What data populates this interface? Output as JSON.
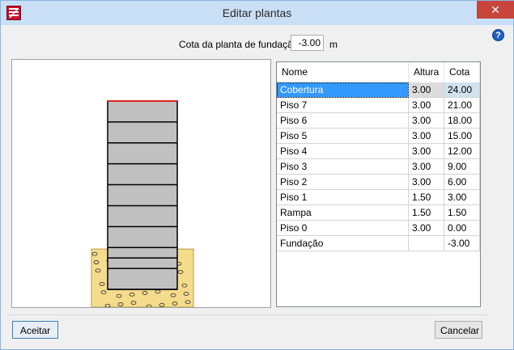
{
  "window": {
    "title": "Editar plantas",
    "close_glyph": "✕",
    "app_icon": "app-logo-icon",
    "help_glyph": "?"
  },
  "foundation": {
    "label": "Cota da planta de fundação",
    "value": "-3.00",
    "unit": "m"
  },
  "table": {
    "headers": {
      "nome": "Nome",
      "altura": "Altura",
      "cota": "Cota"
    },
    "rows": [
      {
        "nome": "Cobertura",
        "altura": "3.00",
        "cota": "24.00",
        "selected": true
      },
      {
        "nome": "Piso 7",
        "altura": "3.00",
        "cota": "21.00"
      },
      {
        "nome": "Piso 6",
        "altura": "3.00",
        "cota": "18.00"
      },
      {
        "nome": "Piso 5",
        "altura": "3.00",
        "cota": "15.00"
      },
      {
        "nome": "Piso 4",
        "altura": "3.00",
        "cota": "12.00"
      },
      {
        "nome": "Piso 3",
        "altura": "3.00",
        "cota": "9.00"
      },
      {
        "nome": "Piso 2",
        "altura": "3.00",
        "cota": "6.00"
      },
      {
        "nome": "Piso 1",
        "altura": "1.50",
        "cota": "3.00"
      },
      {
        "nome": "Rampa",
        "altura": "1.50",
        "cota": "1.50"
      },
      {
        "nome": "Piso 0",
        "altura": "3.00",
        "cota": "0.00"
      },
      {
        "nome": "Fundação",
        "altura": "",
        "cota": "-3.00"
      }
    ]
  },
  "buttons": {
    "ok": "Aceitar",
    "cancel": "Cancelar"
  },
  "colors": {
    "selected_row": "#3399ff",
    "top_floor_line": "#e02020",
    "soil": "#f5dc8c",
    "building": "#c0c0c0",
    "close": "#c7453b"
  }
}
